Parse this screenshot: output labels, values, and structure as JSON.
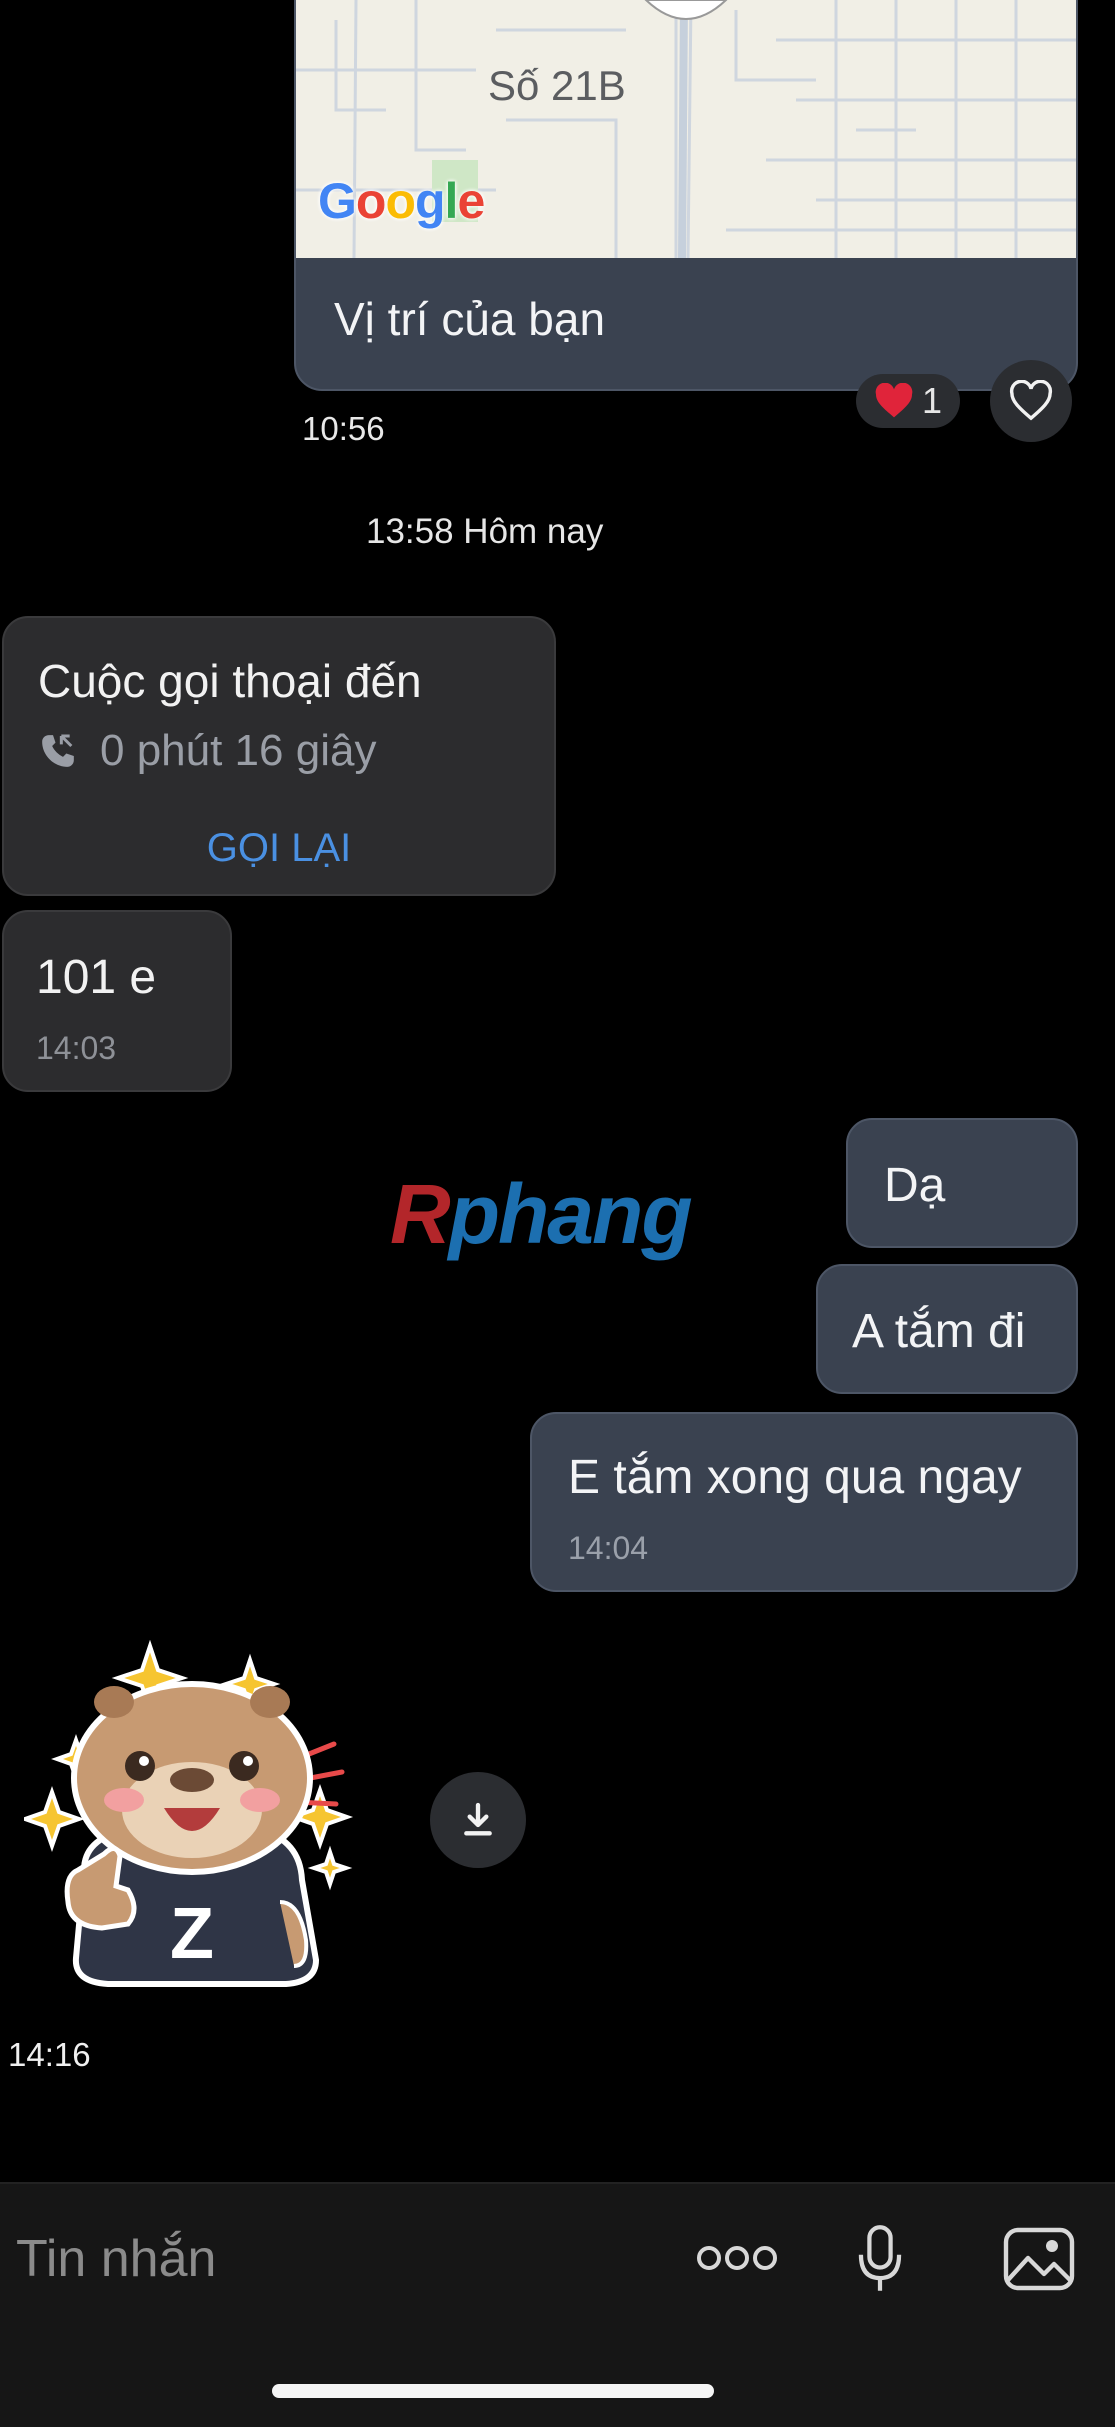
{
  "location_message": {
    "map_street_label": "Số 21B",
    "map_provider_logo": "Google",
    "caption": "Vị trí của bạn",
    "reaction": {
      "icon": "red-heart-icon",
      "count": "1"
    },
    "like_icon": "heart-outline-icon",
    "time": "10:56"
  },
  "day_separator": "13:58 Hôm nay",
  "incoming_call": {
    "title": "Cuộc gọi thoại đến",
    "icon": "incoming-call-icon",
    "duration": "0 phút 16 giây",
    "action": "GỌI LẠI"
  },
  "incoming_message": {
    "text": "101 e",
    "time": "14:03"
  },
  "outgoing_messages": [
    {
      "text": "Dạ",
      "time": ""
    },
    {
      "text": "A tắm đi",
      "time": ""
    },
    {
      "text": "E tắm xong qua ngay",
      "time": "14:04"
    }
  ],
  "watermark": {
    "first": "R",
    "rest": "phang"
  },
  "sticker": {
    "name": "capybara-thumbs-up-sticker",
    "shirt_letter": "Z",
    "time": "14:16",
    "download_icon": "download-icon"
  },
  "composer": {
    "placeholder": "Tin nhắn",
    "icons": [
      "more-dots-icon",
      "microphone-icon",
      "image-icon"
    ]
  },
  "colors": {
    "background": "#000000",
    "incoming_bubble": "#2c2c2e",
    "outgoing_bubble": "#3a4250",
    "link_blue": "#4a90e2"
  }
}
